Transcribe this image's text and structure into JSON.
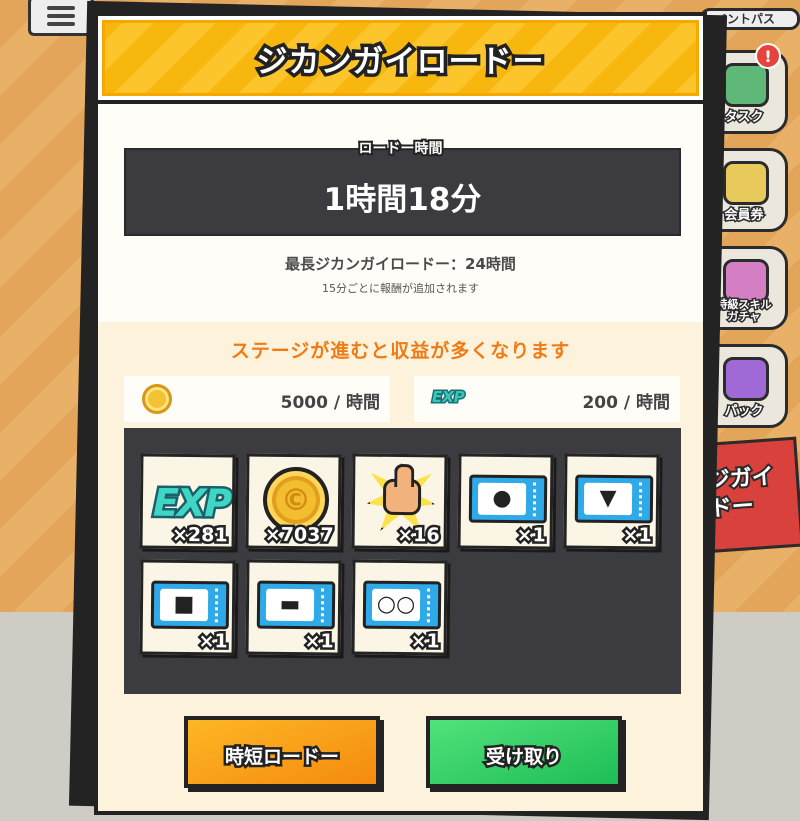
{
  "background": {
    "side_buttons": [
      {
        "label": "ペントパス"
      },
      {
        "label": "タスク",
        "badge": "!"
      },
      {
        "label": "会員券"
      },
      {
        "label": "特級スキル\nガチャ"
      },
      {
        "label": "パック"
      }
    ],
    "side_banner": "ジガイ\nドー"
  },
  "dialog": {
    "title": "ジカンガイロードー",
    "time_label": "ロードー時間",
    "time_value": "1時間18分",
    "max_line": "最長ジカンガイロードー：24時間",
    "note": "15分ごとに報酬が追加されます",
    "stage_text": "ステージが進むと収益が多くなります",
    "rates": {
      "coin": {
        "icon": "coin-icon",
        "value": "5000 / 時間"
      },
      "exp": {
        "icon": "exp-icon",
        "label": "EXP",
        "value": "200 / 時間"
      }
    },
    "rewards": [
      {
        "icon": "exp-icon",
        "label": "EXP",
        "qty": "×281"
      },
      {
        "icon": "coin-icon",
        "qty": "×7037"
      },
      {
        "icon": "thumbs-up-icon",
        "qty": "×16"
      },
      {
        "icon": "hair-ticket-icon",
        "qty": "×1"
      },
      {
        "icon": "suit-ticket-icon",
        "qty": "×1"
      },
      {
        "icon": "shirt-ticket-icon",
        "qty": "×1"
      },
      {
        "icon": "shoes-ticket-icon",
        "qty": "×1"
      },
      {
        "icon": "glasses-ticket-icon",
        "qty": "×1"
      }
    ],
    "buttons": {
      "shorten": "時短ロードー",
      "claim": "受け取り"
    }
  },
  "colors": {
    "header_yellow": "#f8b70f",
    "accent_orange": "#f07b15",
    "panel_dark": "#3c3b40",
    "button_orange": "#f58a0f",
    "button_green": "#1ebd56",
    "ticket_blue": "#2fa9e8"
  }
}
